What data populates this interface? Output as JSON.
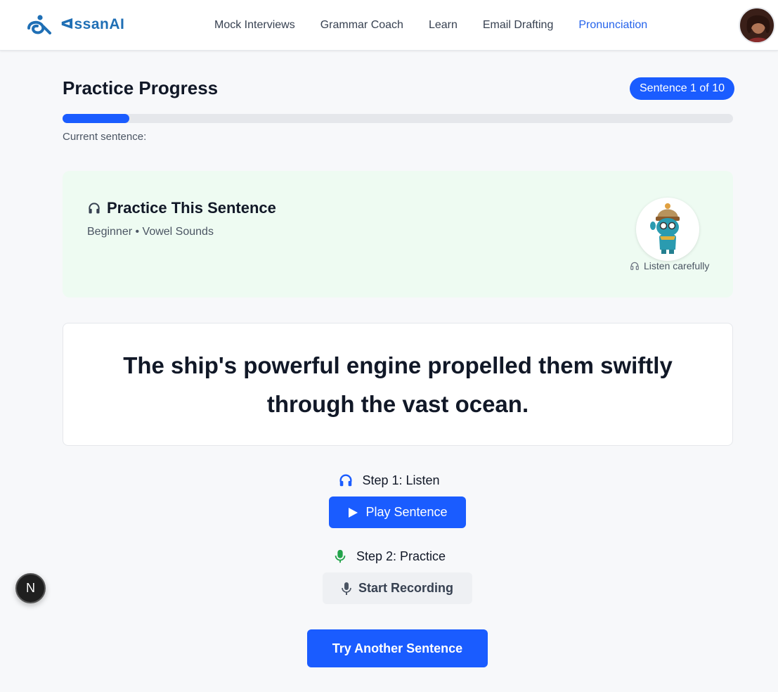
{
  "header": {
    "brand": "ᐊssanAI",
    "nav": [
      {
        "label": "Mock Interviews",
        "active": false
      },
      {
        "label": "Grammar Coach",
        "active": false
      },
      {
        "label": "Learn",
        "active": false
      },
      {
        "label": "Email Drafting",
        "active": false
      },
      {
        "label": "Pronunciation",
        "active": true
      }
    ],
    "avatar_icon": "user-avatar"
  },
  "progress": {
    "title": "Practice Progress",
    "badge": "Sentence 1 of 10",
    "fraction": 0.1,
    "current_label": "Current sentence:"
  },
  "practice": {
    "title": "Practice This Sentence",
    "subtitle": "Beginner • Vowel Sounds",
    "mascot_caption": "Listen carefully",
    "icon": "headphones-icon"
  },
  "sentence": {
    "text": "The ship's powerful engine propelled them swiftly through the vast ocean."
  },
  "steps": {
    "step1_label": "Step 1: Listen",
    "play_label": "Play Sentence",
    "step2_label": "Step 2: Practice",
    "record_label": "Start Recording"
  },
  "actions": {
    "another_label": "Try Another Sentence"
  },
  "dev_badge": "N",
  "colors": {
    "primary": "#1a5cff",
    "brand": "#1f6fb5",
    "practice_bg": "#eefbf2",
    "mic_green": "#22a34a"
  }
}
